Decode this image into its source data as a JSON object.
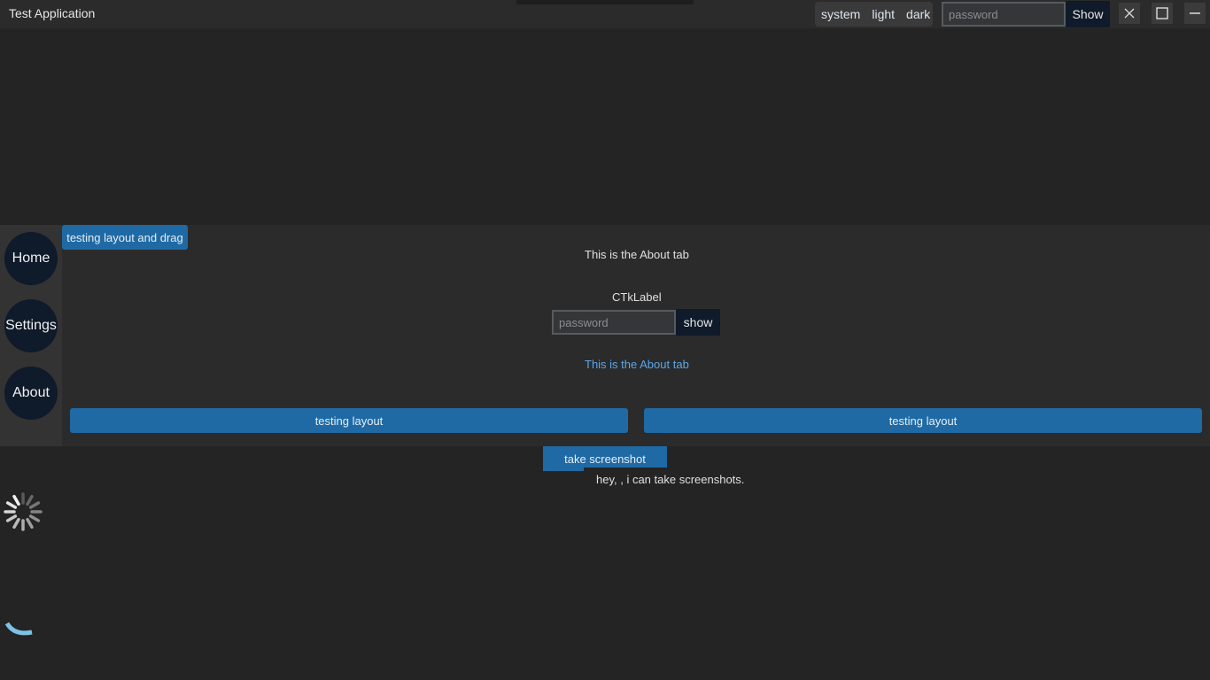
{
  "window": {
    "title": "Test Application",
    "appearance_modes": [
      "system",
      "light",
      "dark"
    ],
    "password_placeholder": "password",
    "show_label": "Show",
    "close_icon": "close-icon",
    "maximize_icon": "maximize-icon",
    "minimize_icon": "minimize-icon"
  },
  "sidebar": {
    "items": [
      {
        "label": "Home"
      },
      {
        "label": "Settings"
      },
      {
        "label": "About"
      }
    ]
  },
  "main": {
    "drag_button_label": "testing layout and drag",
    "about_text": "This is the About tab",
    "ctk_label": "CTkLabel",
    "password_placeholder": "password",
    "show_label": "show",
    "about_text_link": "This is the About tab",
    "layout_button_left": "testing layout",
    "layout_button_right": "testing layout",
    "screenshot_button": "take screenshot",
    "screenshot_message": "hey, , i can take screenshots."
  },
  "colors": {
    "accent": "#1f6aa5",
    "link": "#5aa7ec",
    "dark_button": "#0f1a2a",
    "spinner_arc": "#7cc3e6"
  },
  "icons": [
    "loading-spinner-icon",
    "progress-arc-icon"
  ]
}
